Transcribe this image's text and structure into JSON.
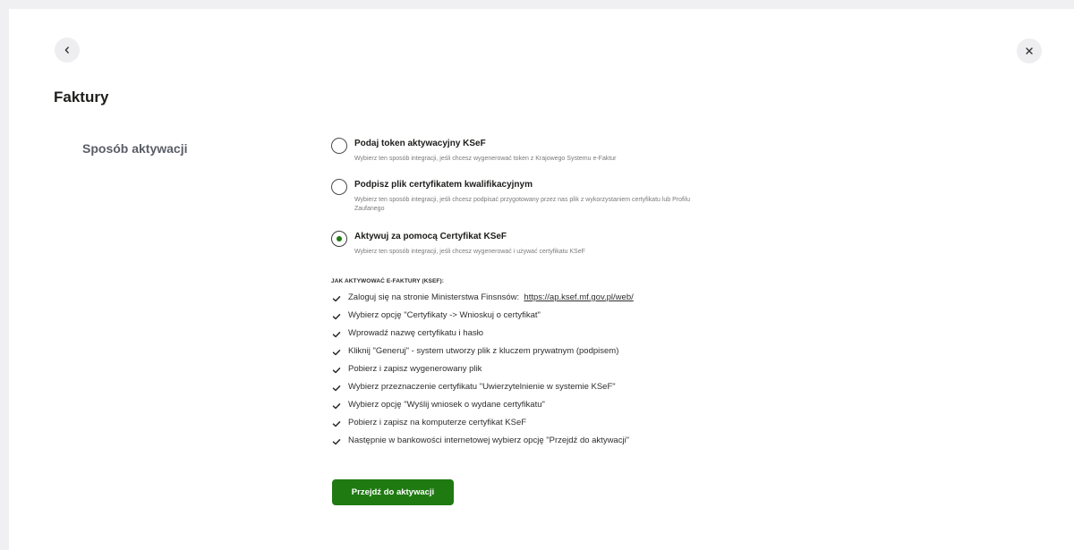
{
  "header": {
    "back_icon": "chevron-left-icon",
    "close_icon": "close-icon",
    "title": "Faktury"
  },
  "section": {
    "label": "Sposób aktywacji"
  },
  "options": [
    {
      "title": "Podaj token aktywacyjny KSeF",
      "description": "Wybierz ten sposób integracji, jeśli chcesz wygenerować token z Krajowego Systemu e-Faktur",
      "selected": false
    },
    {
      "title": "Podpisz plik certyfikatem kwalifikacyjnym",
      "description": "Wybierz ten sposób integracji, jeśli chcesz podpisać przygotowany przez nas plik z wykorzystaniem certyfikatu lub Profilu Zaufanego",
      "selected": false
    },
    {
      "title": "Aktywuj za pomocą Certyfikat KSeF",
      "description": "Wybierz ten sposób integracji, jeśli chcesz wygenerować i używać certyfikatu KSeF",
      "selected": true
    }
  ],
  "howto": {
    "header": "JAK AKTYWOWAĆ E-FAKTURY (KSEF):",
    "step1_prefix": "Zaloguj się na stronie Ministerstwa Finsnsów:",
    "step1_link": "https://ap.ksef.mf.gov.pl/web/",
    "steps": [
      "Wybierz opcję \"Certyfikaty -> Wnioskuj o certyfikat\"",
      "Wprowadź nazwę certyfikatu i hasło",
      "Kliknij \"Generuj\" - system utworzy plik z kluczem prywatnym (podpisem)",
      "Pobierz i zapisz wygenerowany plik",
      "Wybierz przeznaczenie certyfikatu \"Uwierzytelnienie w systemie KSeF\"",
      "Wybierz opcję \"Wyślij wniosek o wydane certyfikatu\"",
      "Pobierz i zapisz na komputerze certyfikat KSeF",
      "Następnie w bankowości internetowej wybierz opcję \"Przejdź do aktywacji\""
    ]
  },
  "actions": {
    "submit_label": "Przejdź do aktywacji"
  },
  "colors": {
    "accent": "#1f7a12",
    "background": "#f0f0f2",
    "panel": "#ffffff"
  }
}
